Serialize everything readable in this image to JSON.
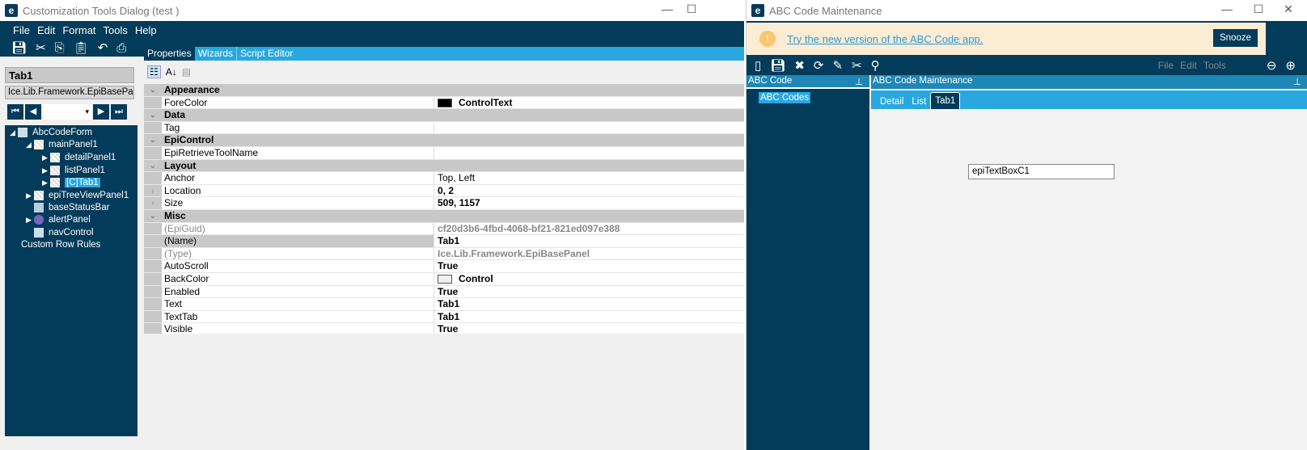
{
  "left": {
    "title": "Customization Tools Dialog  (test )",
    "menu": [
      "File",
      "Edit",
      "Format",
      "Tools",
      "Help"
    ],
    "tabs": [
      "Properties",
      "Wizards",
      "Script Editor"
    ],
    "selected_control": "Tab1",
    "control_type": "Ice.Lib.Framework.EpiBasePa",
    "tree": [
      {
        "label": "AbcCodeForm"
      },
      {
        "label": "mainPanel1"
      },
      {
        "label": "detailPanel1"
      },
      {
        "label": "listPanel1"
      },
      {
        "label": "[C]Tab1"
      },
      {
        "label": "epiTreeViewPanel1"
      },
      {
        "label": "baseStatusBar"
      },
      {
        "label": "alertPanel"
      },
      {
        "label": "navControl"
      },
      {
        "label": "Custom Row Rules"
      }
    ],
    "grid": [
      {
        "cat": "Appearance"
      },
      {
        "name": "ForeColor",
        "value": "ControlText",
        "swatch": "#000000"
      },
      {
        "cat": "Data"
      },
      {
        "name": "Tag",
        "value": ""
      },
      {
        "cat": "EpiControl"
      },
      {
        "name": "EpiRetrieveToolName",
        "value": ""
      },
      {
        "cat": "Layout"
      },
      {
        "name": "Anchor",
        "value": "Top, Left",
        "normal": true
      },
      {
        "name": "Location",
        "value": "0, 2",
        "exp": true
      },
      {
        "name": "Size",
        "value": "509, 1157",
        "exp": true
      },
      {
        "cat": "Misc"
      },
      {
        "name": "(EpiGuid)",
        "value": "cf20d3b6-4fbd-4068-bf21-821ed097e388",
        "grey": true
      },
      {
        "name": "(Name)",
        "value": "Tab1",
        "sel": true
      },
      {
        "name": "(Type)",
        "value": "Ice.Lib.Framework.EpiBasePanel",
        "grey": true
      },
      {
        "name": "AutoScroll",
        "value": "True"
      },
      {
        "name": "BackColor",
        "value": "Control",
        "swatch": "#efefef"
      },
      {
        "name": "Enabled",
        "value": "True"
      },
      {
        "name": "Text",
        "value": "Tab1"
      },
      {
        "name": "TextTab",
        "value": "Tab1"
      },
      {
        "name": "Visible",
        "value": "True"
      }
    ]
  },
  "right": {
    "title": "ABC Code Maintenance",
    "banner": "Try the new version of the ABC Code app.",
    "snooze": "Snooze",
    "menu": [
      "File",
      "Edit",
      "Tools"
    ],
    "tree_header": "ABC Code",
    "tree_item": "ABC Codes",
    "main_header": "ABC Code Maintenance",
    "tabs": [
      "Detail",
      "List",
      "Tab1"
    ],
    "textbox": "epiTextBoxC1"
  }
}
